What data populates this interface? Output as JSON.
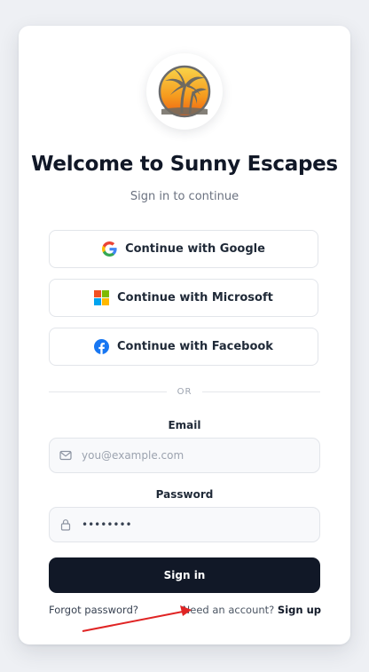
{
  "app": {
    "title": "Welcome to Sunny Escapes",
    "subtitle": "Sign in to continue",
    "logo_icon": "palm-tree-sunset-logo"
  },
  "social": {
    "google_label": "Continue with Google",
    "microsoft_label": "Continue with Microsoft",
    "facebook_label": "Continue with Facebook"
  },
  "divider_text": "OR",
  "form": {
    "email_label": "Email",
    "email_placeholder": "you@example.com",
    "email_value": "",
    "password_label": "Password",
    "password_value": "••••••••",
    "submit_label": "Sign in"
  },
  "footer": {
    "forgot_label": "Forgot password?",
    "need_account_text": "Need an account?",
    "signup_label": "Sign up"
  },
  "colors": {
    "primary_button": "#111827",
    "annotation_arrow": "#e02424",
    "logo_gradient_top": "#f7c93a",
    "logo_gradient_bottom": "#f06a12"
  }
}
